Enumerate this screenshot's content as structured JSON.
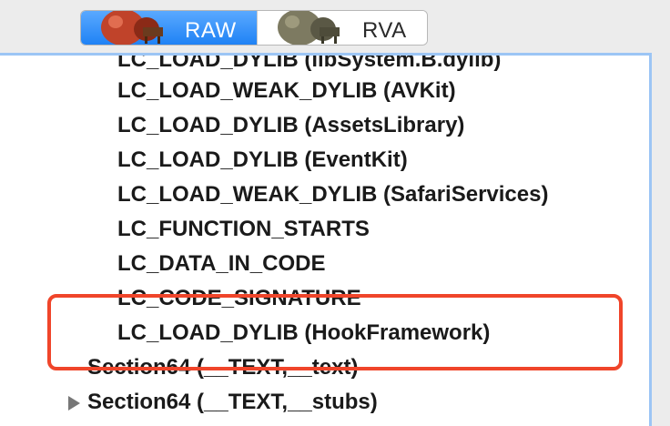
{
  "toolbar": {
    "segments": [
      {
        "label": "RAW",
        "icon": "red-apple-icon",
        "selected": true
      },
      {
        "label": "RVA",
        "icon": "gray-apple-icon",
        "selected": false
      }
    ]
  },
  "tree": {
    "rows": [
      {
        "label": "LC_LOAD_DYLIB (libSystem.B.dylib)",
        "kind": "load-command"
      },
      {
        "label": "LC_LOAD_WEAK_DYLIB (AVKit)",
        "kind": "load-command"
      },
      {
        "label": "LC_LOAD_DYLIB (AssetsLibrary)",
        "kind": "load-command"
      },
      {
        "label": "LC_LOAD_DYLIB (EventKit)",
        "kind": "load-command"
      },
      {
        "label": "LC_LOAD_WEAK_DYLIB (SafariServices)",
        "kind": "load-command"
      },
      {
        "label": "LC_FUNCTION_STARTS",
        "kind": "load-command"
      },
      {
        "label": "LC_DATA_IN_CODE",
        "kind": "load-command"
      },
      {
        "label": "LC_CODE_SIGNATURE",
        "kind": "load-command"
      },
      {
        "label": "LC_LOAD_DYLIB (HookFramework)",
        "kind": "load-command"
      },
      {
        "label": "Section64 (__TEXT,__text)",
        "kind": "section"
      },
      {
        "label": "Section64 (__TEXT,__stubs)",
        "kind": "section",
        "collapsed": true
      }
    ]
  },
  "colors": {
    "selection_blue": "#1f82f5",
    "annotation_red": "#f0452a",
    "panel_border": "#9cc5f5"
  }
}
